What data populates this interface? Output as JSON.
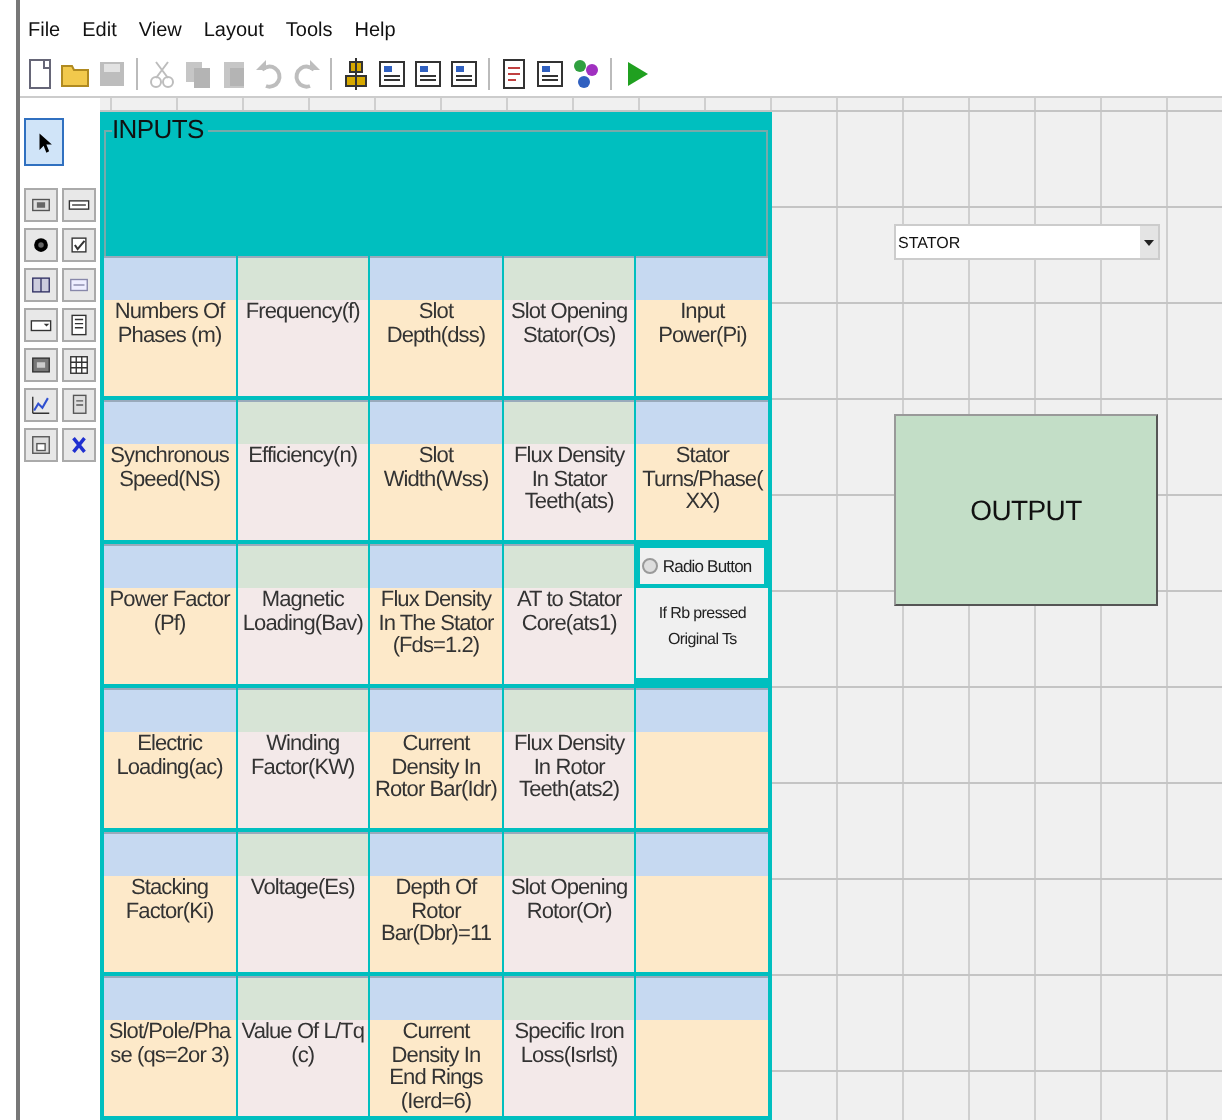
{
  "menu": [
    {
      "label": "File"
    },
    {
      "label": "Edit"
    },
    {
      "label": "View"
    },
    {
      "label": "Layout"
    },
    {
      "label": "Tools"
    },
    {
      "label": "Help"
    }
  ],
  "toolbar": [
    {
      "kind": "new",
      "disabled": false
    },
    {
      "kind": "open",
      "disabled": false
    },
    {
      "kind": "save",
      "disabled": true
    },
    {
      "kind": "cut",
      "disabled": true
    },
    {
      "kind": "copy",
      "disabled": true
    },
    {
      "kind": "paste",
      "disabled": true
    },
    {
      "kind": "undo",
      "disabled": true
    },
    {
      "kind": "redo",
      "disabled": true
    },
    {
      "kind": "align",
      "disabled": false
    },
    {
      "kind": "form",
      "disabled": false
    },
    {
      "kind": "form",
      "disabled": false
    },
    {
      "kind": "form",
      "disabled": false
    },
    {
      "kind": "page",
      "disabled": false
    },
    {
      "kind": "form",
      "disabled": false
    },
    {
      "kind": "tree",
      "disabled": false
    },
    {
      "kind": "run",
      "disabled": false
    }
  ],
  "pointer_tool": {
    "selected": true
  },
  "toolbox": [
    {
      "kind": "label"
    },
    {
      "kind": "textbox"
    },
    {
      "kind": "radio"
    },
    {
      "kind": "checkbox"
    },
    {
      "kind": "button"
    },
    {
      "kind": "text"
    },
    {
      "kind": "combo"
    },
    {
      "kind": "list"
    },
    {
      "kind": "picture"
    },
    {
      "kind": "grid"
    },
    {
      "kind": "chart"
    },
    {
      "kind": "report"
    },
    {
      "kind": "subform"
    },
    {
      "kind": "delete"
    }
  ],
  "inputs": {
    "title": "INPUTS",
    "rows": [
      {
        "fields": [
          {
            "kind": "input",
            "label": "Numbers Of Phases (m)"
          },
          {
            "kind": "input",
            "label": "Frequency(f)"
          },
          {
            "kind": "input",
            "label": "Slot Depth(dss)"
          },
          {
            "kind": "input",
            "label": "Slot Opening Stator(Os)"
          },
          {
            "kind": "input",
            "label": "Input Power(Pi)"
          }
        ]
      },
      {
        "fields": [
          {
            "kind": "input",
            "label": "Synchronous Speed(NS)"
          },
          {
            "kind": "input",
            "label": "Efficiency(n)"
          },
          {
            "kind": "input",
            "label": "Slot Width(Wss)"
          },
          {
            "kind": "input",
            "label": "Flux Density In Stator Teeth(ats)"
          },
          {
            "kind": "input",
            "label": "Stator Turns/Phase(XX)"
          }
        ]
      },
      {
        "fields": [
          {
            "kind": "input",
            "label": "Power Factor (Pf)"
          },
          {
            "kind": "input",
            "label": "Magnetic Loading(Bav)"
          },
          {
            "kind": "input",
            "label": "Flux Density In The Stator (Fds=1.2)"
          },
          {
            "kind": "input",
            "label": "AT to Stator Core(ats1)"
          },
          {
            "kind": "radio",
            "label": "Radio Button",
            "selected": false,
            "note": "If Rb pressed Original Ts"
          }
        ]
      },
      {
        "fields": [
          {
            "kind": "input",
            "label": "Electric Loading(ac)"
          },
          {
            "kind": "input",
            "label": "Winding Factor(KW)"
          },
          {
            "kind": "input",
            "label": "Current Density In Rotor Bar(Idr)"
          },
          {
            "kind": "input",
            "label": "Flux Density In Rotor Teeth(ats2)"
          },
          {
            "kind": "empty"
          }
        ]
      },
      {
        "fields": [
          {
            "kind": "input",
            "label": "Stacking Factor(Ki)"
          },
          {
            "kind": "input",
            "label": "Voltage(Es)"
          },
          {
            "kind": "input",
            "label": "Depth Of Rotor Bar(Dbr)=11"
          },
          {
            "kind": "input",
            "label": "Slot Opening Rotor(Or)"
          },
          {
            "kind": "empty"
          }
        ]
      },
      {
        "fields": [
          {
            "kind": "input",
            "label": "Slot/Pole/Phase (qs=2or 3)"
          },
          {
            "kind": "input",
            "label": "Value Of L/Tq (c)"
          },
          {
            "kind": "input",
            "label": "Current Density In End Rings (Ierd=6)"
          },
          {
            "kind": "input",
            "label": "Specific Iron Loss(Isrlst)"
          },
          {
            "kind": "empty"
          }
        ]
      }
    ]
  },
  "dropdown": {
    "value": "STATOR"
  },
  "output_button": {
    "label": "OUTPUT"
  }
}
